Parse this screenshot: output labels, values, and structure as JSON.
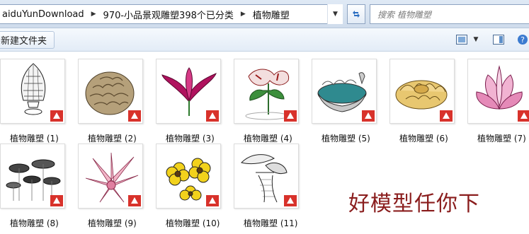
{
  "address": {
    "crumbs": [
      "aiduYunDownload",
      "970-小品景观雕塑398个已分类",
      "植物雕塑"
    ]
  },
  "search": {
    "placeholder": "搜索 植物雕塑"
  },
  "toolbar": {
    "new_folder_label": "新建文件夹"
  },
  "files": [
    {
      "label": "植物雕塑 (1)",
      "icon": "pinecone-sculpture-thumbnail"
    },
    {
      "label": "植物雕塑 (2)",
      "icon": "artichoke-sculpture-thumbnail"
    },
    {
      "label": "植物雕塑 (3)",
      "icon": "magenta-flower-thumbnail"
    },
    {
      "label": "植物雕塑 (4)",
      "icon": "lily-sculpture-thumbnail"
    },
    {
      "label": "植物雕塑 (5)",
      "icon": "lotus-fountain-thumbnail"
    },
    {
      "label": "植物雕塑 (6)",
      "icon": "gold-flower-thumbnail"
    },
    {
      "label": "植物雕塑 (7)",
      "icon": "pink-lotus-thumbnail"
    },
    {
      "label": "植物雕塑 (8)",
      "icon": "lotus-leaves-thumbnail"
    },
    {
      "label": "植物雕塑 (9)",
      "icon": "pink-agave-thumbnail"
    },
    {
      "label": "植物雕塑 (10)",
      "icon": "yellow-flowers-thumbnail"
    },
    {
      "label": "植物雕塑 (11)",
      "icon": "plant-wireframe-thumbnail"
    }
  ],
  "watermark": "好模型任你下",
  "colors": {
    "sketchup_badge": "#d8322b",
    "watermark": "#8a1d1d",
    "accent": "#cfdcec"
  }
}
